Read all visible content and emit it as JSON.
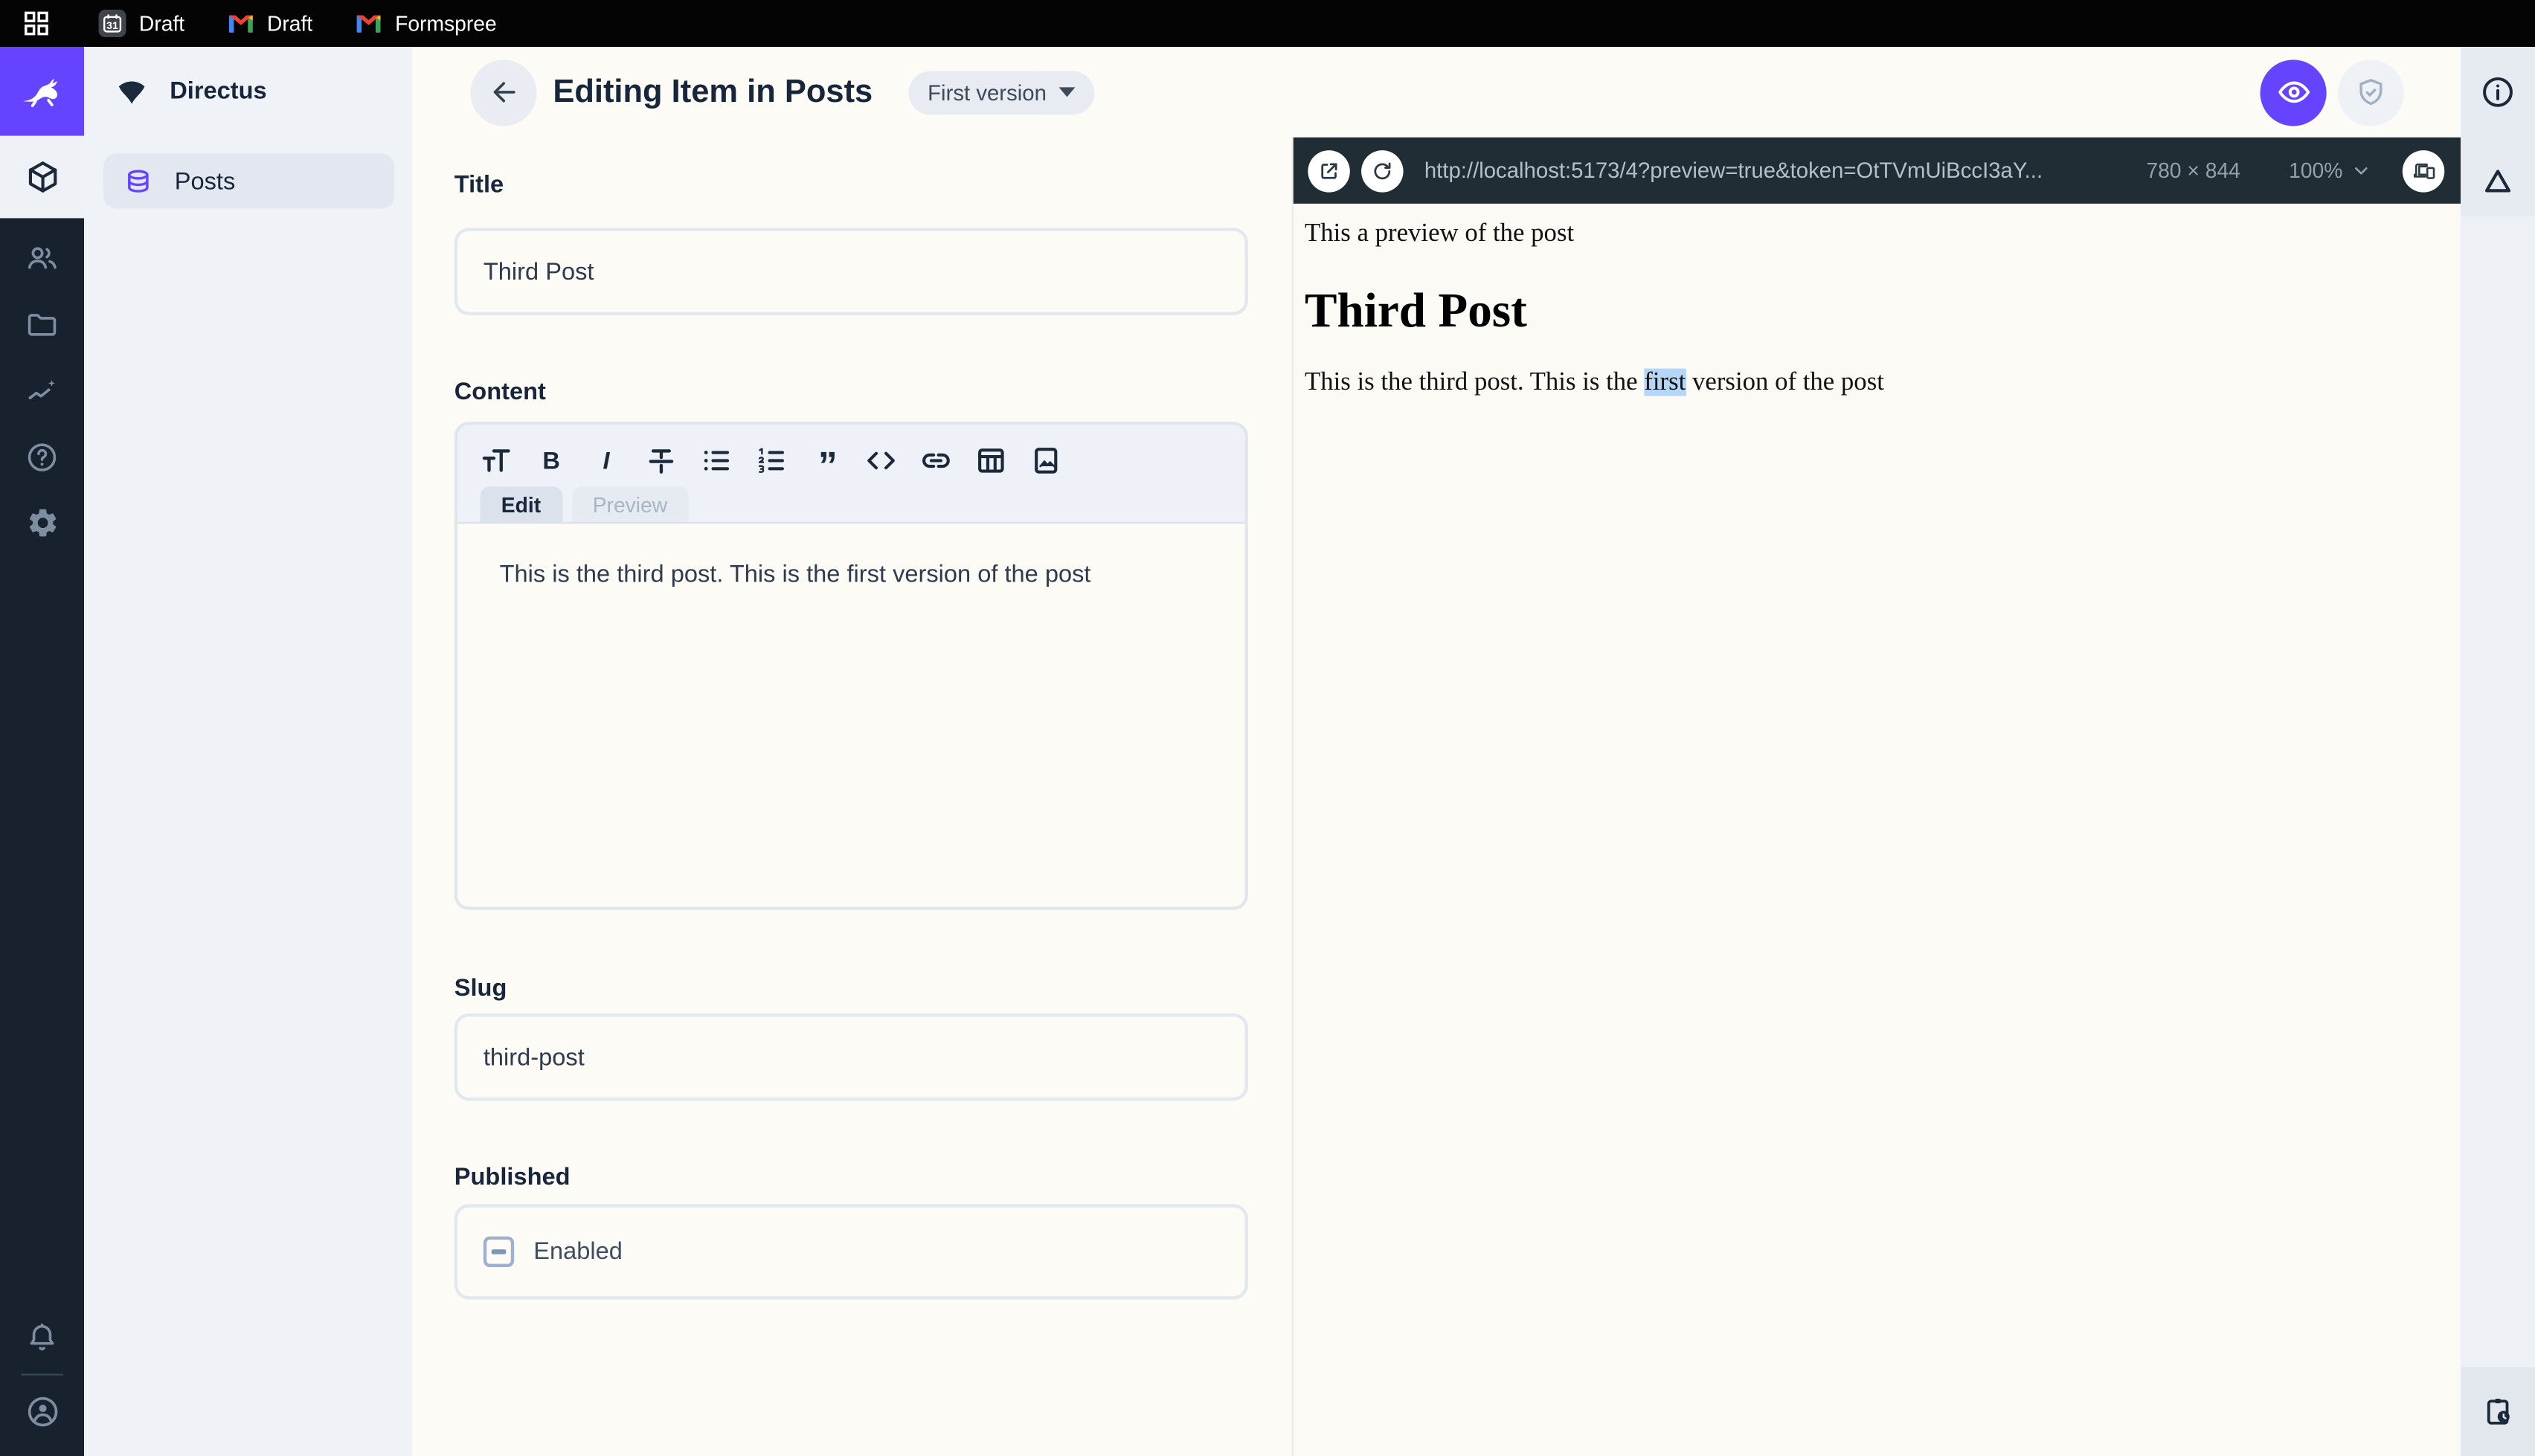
{
  "browser_bar": {
    "tabs": [
      {
        "label": "Draft",
        "icon": "calendar-icon",
        "icon_text": "31"
      },
      {
        "label": "Draft",
        "icon": "gmail-icon"
      },
      {
        "label": "Formspree",
        "icon": "gmail-icon"
      }
    ]
  },
  "module_bar": {
    "icons": [
      "directus-rabbit-logo",
      "cube-icon",
      "users-icon",
      "folder-icon",
      "insights-icon",
      "help-icon",
      "settings-icon",
      "bell-icon",
      "avatar-icon"
    ]
  },
  "nav": {
    "project_name": "Directus",
    "project_icon": "directus-mark-icon",
    "items": [
      {
        "label": "Posts",
        "icon": "database-icon",
        "active": true
      }
    ]
  },
  "header": {
    "title": "Editing Item in Posts",
    "version_label": "First version",
    "icons": [
      "back-arrow-icon",
      "eye-icon",
      "shield-check-icon"
    ]
  },
  "form": {
    "title_field": {
      "label": "Title",
      "value": "Third Post"
    },
    "content_field": {
      "label": "Content",
      "toolbar_icons": [
        "format-size",
        "bold",
        "italic",
        "strikethrough",
        "bulleted-list",
        "numbered-list",
        "blockquote",
        "code",
        "link",
        "table",
        "image"
      ],
      "bold_glyph": "B",
      "italic_glyph": "I",
      "quote_glyph": "”",
      "edit_tab": "Edit",
      "preview_tab": "Preview",
      "value": "This is the third post. This is the first version of the post"
    },
    "slug_field": {
      "label": "Slug",
      "value": "third-post"
    },
    "published_field": {
      "label": "Published",
      "checkbox_label": "Enabled",
      "checkbox_state": "indeterminate"
    }
  },
  "preview_panel": {
    "url": "http://localhost:5173/4?preview=true&token=OtTVmUiBccI3aY...",
    "size": "780 × 844",
    "zoom": "100%",
    "icons": [
      "external-link-icon",
      "refresh-icon",
      "chevron-down-icon",
      "responsive-devices-icon"
    ],
    "content": {
      "intro": "This a preview of the post",
      "heading": "Third Post",
      "body_before": "This is the third post. This is the ",
      "highlighted_word": "first",
      "body_after": " version of the post"
    }
  },
  "right_sidebar": {
    "icons": [
      "info-icon",
      "triangle-icon",
      "revisions-clipboard-clock-icon"
    ]
  },
  "colors": {
    "accent": "#6644ff",
    "module_bar_bg": "#18222f",
    "preview_toolbar_bg": "#202d34",
    "nav_bg": "#eff2f7",
    "content_bg": "#fdfbf5",
    "selection_highlight": "#b6d6f8"
  }
}
